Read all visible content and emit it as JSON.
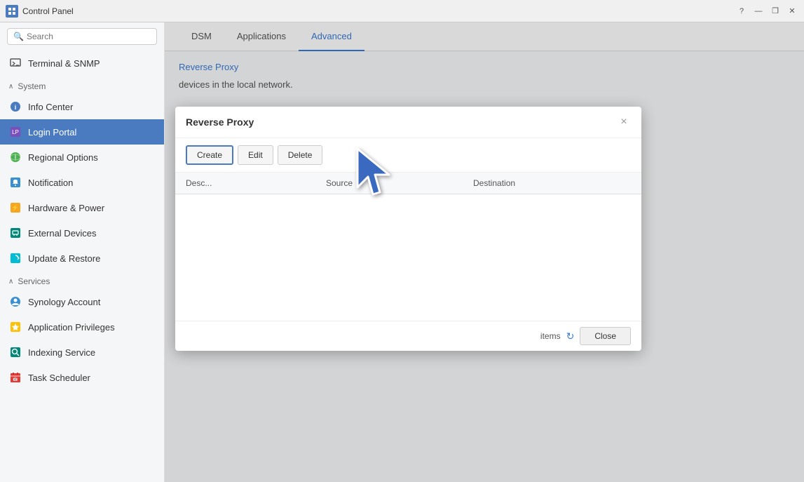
{
  "titlebar": {
    "title": "Control Panel",
    "buttons": [
      "help",
      "minimize",
      "restore",
      "close"
    ]
  },
  "sidebar": {
    "search_placeholder": "Search",
    "terminal_snmp": "Terminal & SNMP",
    "system_section": "System",
    "items": [
      {
        "id": "info-center",
        "label": "Info Center",
        "color": "blue"
      },
      {
        "id": "login-portal",
        "label": "Login Portal",
        "color": "purple",
        "active": true
      },
      {
        "id": "regional-options",
        "label": "Regional Options",
        "color": "green"
      },
      {
        "id": "notification",
        "label": "Notification",
        "color": "blue"
      },
      {
        "id": "hardware-power",
        "label": "Hardware & Power",
        "color": "orange"
      },
      {
        "id": "external-devices",
        "label": "External Devices",
        "color": "teal"
      },
      {
        "id": "update-restore",
        "label": "Update & Restore",
        "color": "cyan"
      }
    ],
    "services_section": "Services",
    "service_items": [
      {
        "id": "synology-account",
        "label": "Synology Account",
        "color": "blue"
      },
      {
        "id": "application-privileges",
        "label": "Application Privileges",
        "color": "yellow"
      },
      {
        "id": "indexing-service",
        "label": "Indexing Service",
        "color": "teal"
      },
      {
        "id": "task-scheduler",
        "label": "Task Scheduler",
        "color": "red"
      }
    ]
  },
  "content": {
    "tabs": [
      {
        "id": "dsm",
        "label": "DSM"
      },
      {
        "id": "applications",
        "label": "Applications"
      },
      {
        "id": "advanced",
        "label": "Advanced",
        "active": true
      }
    ],
    "breadcrumb": "Reverse Proxy",
    "description": "devices in the local network."
  },
  "dialog": {
    "title": "Reverse Proxy",
    "close_label": "×",
    "toolbar": {
      "create_label": "Create",
      "edit_label": "Edit",
      "delete_label": "Delete"
    },
    "table": {
      "columns": [
        {
          "id": "description",
          "label": "Desc..."
        },
        {
          "id": "source",
          "label": "Source"
        },
        {
          "id": "destination",
          "label": "Destination"
        }
      ]
    },
    "footer": {
      "items_label": "items",
      "close_label": "Close"
    }
  }
}
